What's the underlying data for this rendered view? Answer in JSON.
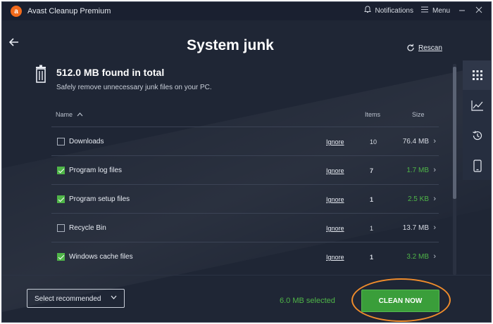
{
  "titlebar": {
    "app_title": "Avast Cleanup Premium",
    "notifications_label": "Notifications",
    "menu_label": "Menu"
  },
  "header": {
    "title": "System junk",
    "rescan_label": "Rescan"
  },
  "summary": {
    "found": "512.0 MB found in total",
    "subtitle": "Safely remove unnecessary junk files on your PC."
  },
  "table": {
    "headers": {
      "name": "Name",
      "items": "Items",
      "size": "Size"
    },
    "ignore_label": "Ignore",
    "rows": [
      {
        "name": "Downloads",
        "checked": false,
        "items": "10",
        "size": "76.4 MB"
      },
      {
        "name": "Program log files",
        "checked": true,
        "items": "7",
        "size": "1.7 MB"
      },
      {
        "name": "Program setup files",
        "checked": true,
        "items": "1",
        "size": "2.5 KB"
      },
      {
        "name": "Recycle Bin",
        "checked": false,
        "items": "1",
        "size": "13.7 MB"
      },
      {
        "name": "Windows cache files",
        "checked": true,
        "items": "1",
        "size": "3.2 MB"
      }
    ]
  },
  "bottom": {
    "select_label": "Select recommended",
    "selected_text": "6.0 MB selected",
    "clean_label": "CLEAN NOW"
  },
  "colors": {
    "background": "#1f2635",
    "accent_green": "#4fb548",
    "highlight_orange": "#f08c2b",
    "logo_orange": "#f26a1b"
  },
  "icons": {
    "logo": "avast-logo-icon",
    "bell": "bell-icon",
    "hamburger": "hamburger-menu-icon",
    "back": "back-arrow-icon",
    "rescan": "rescan-icon",
    "trash": "trash-icon",
    "sidebar": [
      "grid-icon",
      "chart-icon",
      "history-icon",
      "phone-icon"
    ]
  }
}
